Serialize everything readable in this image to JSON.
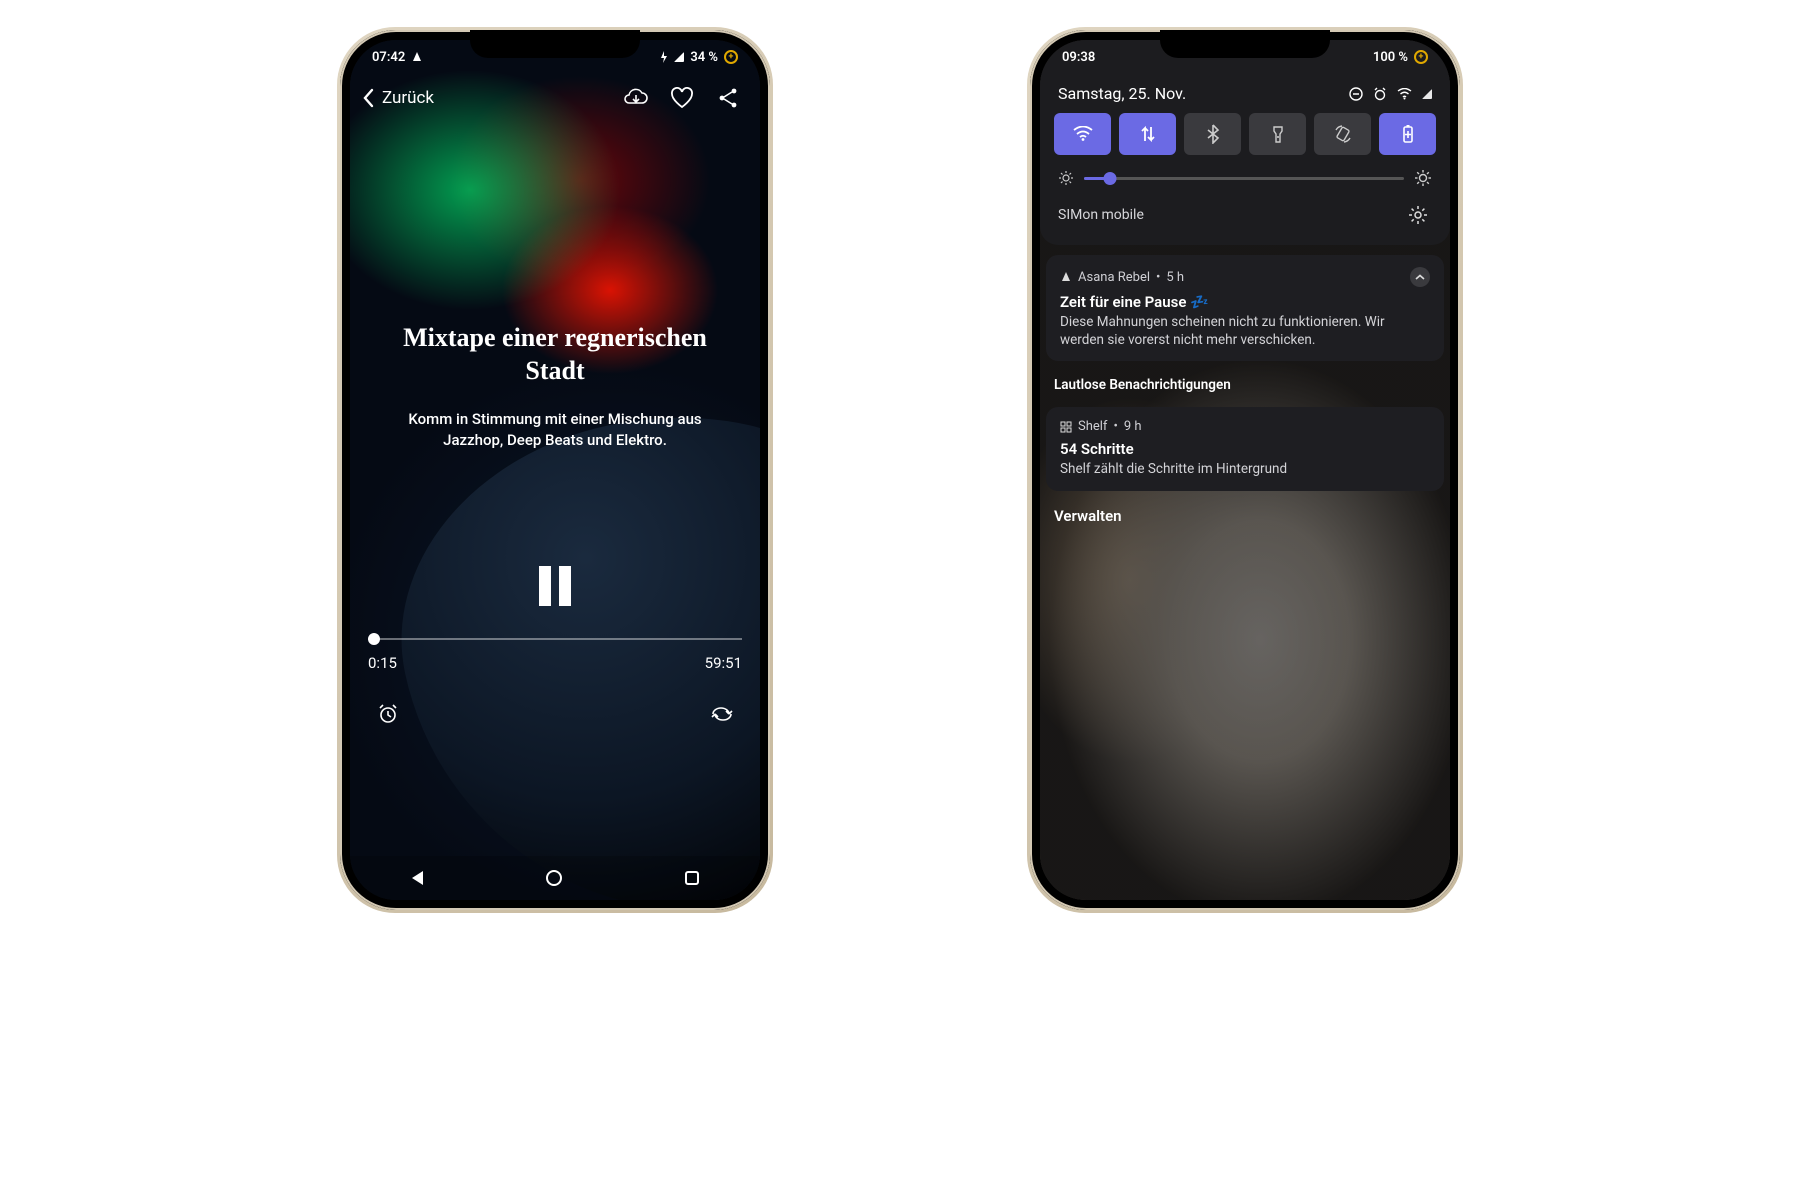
{
  "phone1": {
    "status": {
      "time": "07:42",
      "battery": "34 %"
    },
    "back_label": "Zurück",
    "title": "Mixtape einer regnerischen Stadt",
    "subtitle": "Komm in Stimmung mit einer Mischung aus Jazzhop, Deep Beats und Elektro.",
    "elapsed": "0:15",
    "remaining": "59:51"
  },
  "phone2": {
    "status": {
      "time": "09:38",
      "battery": "100 %"
    },
    "date": "Samstag, 25. Nov.",
    "tiles": {
      "wifi": {
        "icon": "wifi",
        "active": true
      },
      "mobiledata": {
        "icon": "mobile-data",
        "active": true
      },
      "bluetooth": {
        "icon": "bluetooth",
        "active": false
      },
      "flashlight": {
        "icon": "flashlight",
        "active": false
      },
      "rotate": {
        "icon": "auto-rotate",
        "active": false
      },
      "battery": {
        "icon": "battery-saver",
        "active": true
      }
    },
    "brightness_percent": 8,
    "carrier": "SIMon mobile",
    "notif1": {
      "app": "Asana Rebel",
      "age": "5 h",
      "title": "Zeit für eine Pause 💤",
      "body": "Diese Mahnungen scheinen nicht zu funktionieren. Wir werden sie vorerst nicht mehr verschicken."
    },
    "silent_header": "Lautlose Benachrichtigungen",
    "notif2": {
      "app": "Shelf",
      "age": "9 h",
      "title": "54 Schritte",
      "body": "Shelf zählt die Schritte im Hintergrund"
    },
    "manage": "Verwalten"
  }
}
